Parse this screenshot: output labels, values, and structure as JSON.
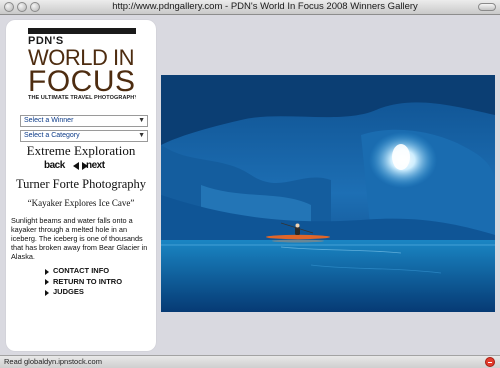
{
  "window": {
    "title": "http://www.pdngallery.com - PDN's World In Focus 2008 Winners Gallery"
  },
  "logo": {
    "line1": "PDN'S",
    "line2": "WORLD IN",
    "line3": "FOCUS",
    "tagline": "THE ULTIMATE TRAVEL PHOTOGRAPHY CONTEST"
  },
  "selects": {
    "winner": "Select a Winner",
    "category": "Select a Category"
  },
  "gallery": {
    "category_title": "Extreme Exploration",
    "back_label": "back",
    "next_label": "next",
    "photographer": "Turner Forte Photography",
    "photo_title": "“Kayaker Explores Ice Cave”",
    "caption": "Sunlight beams and water falls onto a kayaker through a melted hole in an iceberg. The iceberg is one of thousands that has broken away from Bear Glacier in Alaska."
  },
  "links": [
    {
      "label": "CONTACT INFO"
    },
    {
      "label": "RETURN TO INTRO"
    },
    {
      "label": "JUDGES"
    }
  ],
  "status": {
    "text": "Read globaldyn.ipnstock.com"
  },
  "colors": {
    "page_bg": "#d9d9e0",
    "panel_bg": "#ffffff",
    "logo_brown": "#4d2c10",
    "select_text": "#0b3a88"
  }
}
